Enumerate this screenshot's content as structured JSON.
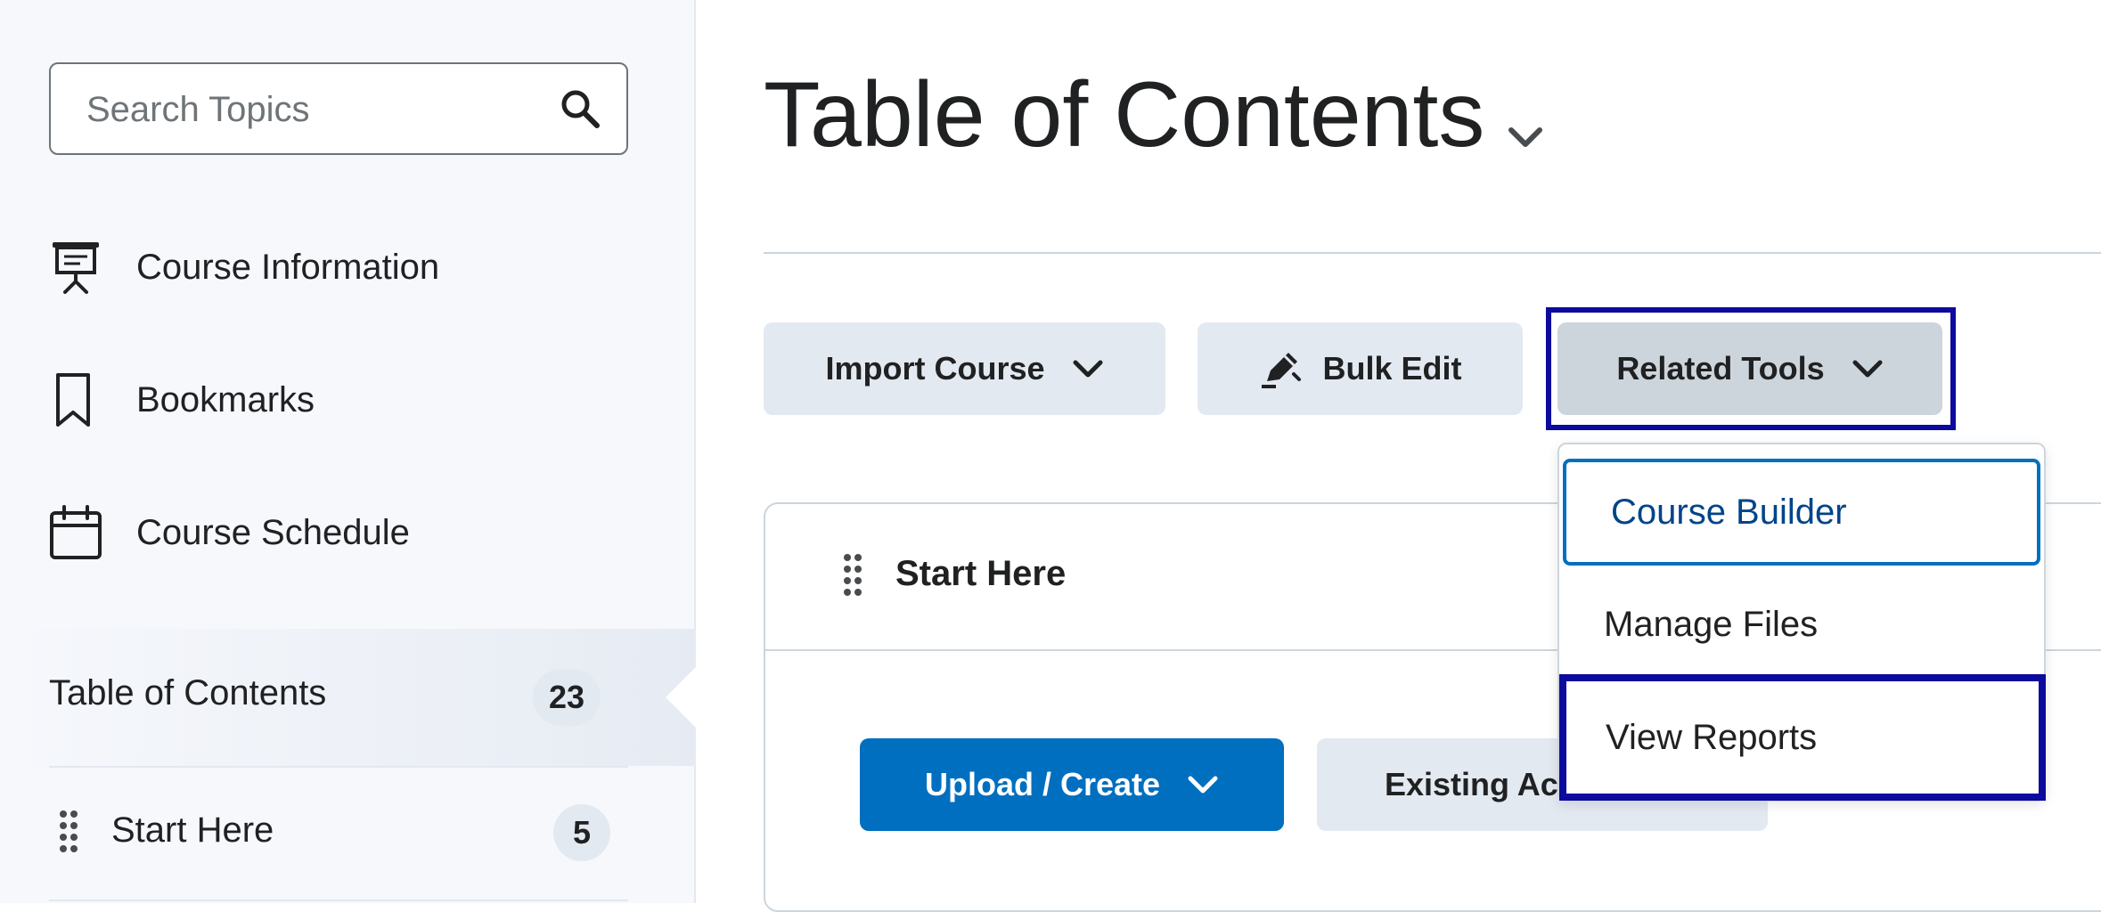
{
  "sidebar": {
    "search": {
      "placeholder": "Search Topics",
      "value": ""
    },
    "items": [
      {
        "label": "Course Information",
        "icon": "presentation-board-icon"
      },
      {
        "label": "Bookmarks",
        "icon": "bookmark-icon"
      },
      {
        "label": "Course Schedule",
        "icon": "calendar-icon"
      }
    ],
    "toc": {
      "label": "Table of Contents",
      "count": "23"
    },
    "modules": [
      {
        "label": "Start Here",
        "count": "5"
      }
    ]
  },
  "main": {
    "title": "Table of Contents",
    "toolbar": {
      "import_label": "Import Course",
      "bulk_edit_label": "Bulk Edit",
      "related_tools_label": "Related Tools"
    },
    "module_card": {
      "title": "Start Here",
      "upload_label": "Upload / Create",
      "existing_label": "Existing Acti"
    }
  },
  "related_tools_menu": {
    "items": [
      {
        "label": "Course Builder"
      },
      {
        "label": "Manage Files"
      },
      {
        "label": "View Reports"
      }
    ]
  },
  "colors": {
    "primary_blue": "#006fbf",
    "focus_outline": "#0d0a9e",
    "button_gray": "#e3e9f1",
    "link_blue": "#004489"
  }
}
